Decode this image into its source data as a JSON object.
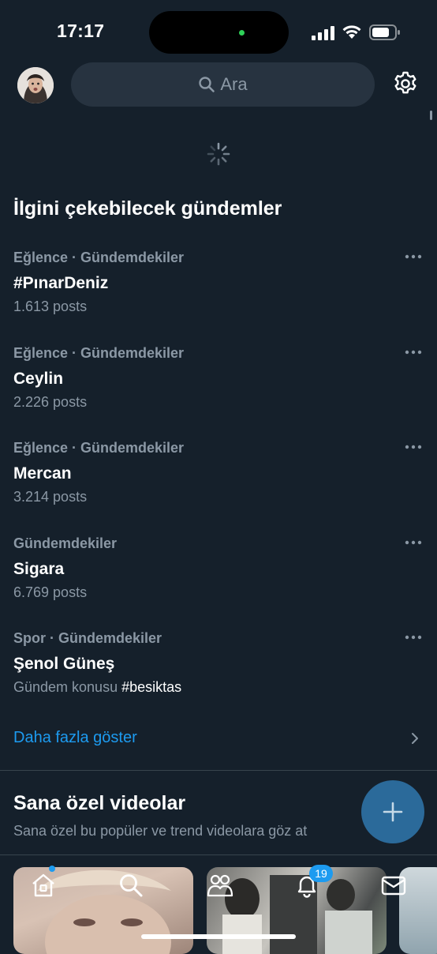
{
  "status_bar": {
    "time": "17:17"
  },
  "header": {
    "search_placeholder": "Ara"
  },
  "trends_section": {
    "title": "İlgini çekebilecek gündemler",
    "items": [
      {
        "meta": "Eğlence · Gündemdekiler",
        "name": "#PınarDeniz",
        "sub": "1.613 posts"
      },
      {
        "meta": "Eğlence · Gündemdekiler",
        "name": "Ceylin",
        "sub": "2.226 posts"
      },
      {
        "meta": "Eğlence · Gündemdekiler",
        "name": "Mercan",
        "sub": "3.214 posts"
      },
      {
        "meta": "Gündemdekiler",
        "name": "Sigara",
        "sub": "6.769 posts"
      },
      {
        "meta": "Spor · Gündemdekiler",
        "name": "Şenol Güneş",
        "sub_prefix": "Gündem konusu ",
        "sub_tag": "#besiktas"
      }
    ],
    "show_more": "Daha fazla göster"
  },
  "videos_section": {
    "title": "Sana özel videolar",
    "subtitle": "Sana özel bu popüler ve trend videolara göz at"
  },
  "tab_bar": {
    "notifications_badge": "19",
    "icons": [
      "home-icon",
      "search-icon",
      "communities-icon",
      "bell-icon",
      "mail-icon"
    ]
  },
  "colors": {
    "background": "#15202b",
    "accent": "#1d9bf0",
    "secondary_text": "#8b98a5",
    "search_bg": "#273340"
  }
}
